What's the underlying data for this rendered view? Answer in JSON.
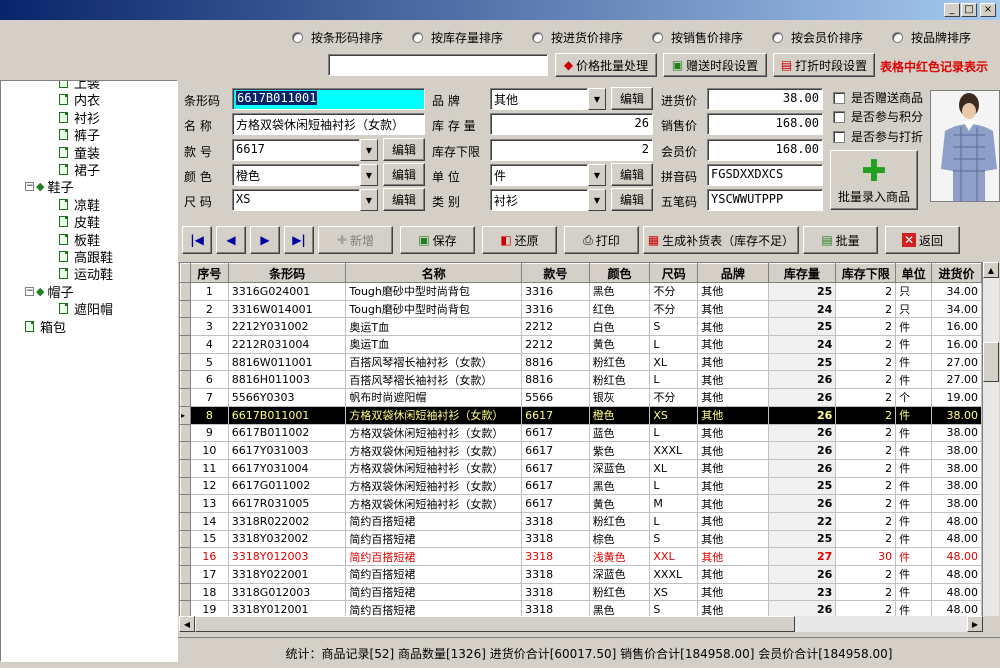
{
  "window": {
    "min": "_",
    "max": "□",
    "close": "×"
  },
  "sort_options": [
    "按条形码排序",
    "按库存量排序",
    "按进货价排序",
    "按销售价排序",
    "按会员价排序",
    "按品牌排序"
  ],
  "toolbar": {
    "search_value": "",
    "price_batch": "价格批量处理",
    "gift_period": "赠送时段设置",
    "discount_period": "打折时段设置",
    "red_notice": "表格中红色记录表示"
  },
  "tree": {
    "items": [
      {
        "label": "上装",
        "level": 2
      },
      {
        "label": "内衣",
        "level": 2
      },
      {
        "label": "衬衫",
        "level": 2
      },
      {
        "label": "裤子",
        "level": 2
      },
      {
        "label": "童装",
        "level": 2
      },
      {
        "label": "裙子",
        "level": 2
      },
      {
        "label": "鞋子",
        "level": 1,
        "expander": "−"
      },
      {
        "label": "凉鞋",
        "level": 2
      },
      {
        "label": "皮鞋",
        "level": 2
      },
      {
        "label": "板鞋",
        "level": 2
      },
      {
        "label": "高跟鞋",
        "level": 2
      },
      {
        "label": "运动鞋",
        "level": 2
      },
      {
        "label": "帽子",
        "level": 1,
        "expander": "−"
      },
      {
        "label": "遮阳帽",
        "level": 2
      },
      {
        "label": "箱包",
        "level": 1
      }
    ]
  },
  "form": {
    "barcode_label": "条形码",
    "barcode": "6617B011001",
    "name_label": "名  称",
    "name": "方格双袋休闲短袖衬衫（女款）",
    "style_label": "款  号",
    "style": "6617",
    "color_label": "颜  色",
    "color": "橙色",
    "size_label": "尺  码",
    "size": "XS",
    "brand_label": "品    牌",
    "brand": "其他",
    "stock_label": "库 存 量",
    "stock": "26",
    "stock_min_label": "库存下限",
    "stock_min": "2",
    "unit_label": "单    位",
    "unit": "件",
    "category_label": "类    别",
    "category": "衬衫",
    "cost_label": "进货价",
    "cost": "38.00",
    "sale_label": "销售价",
    "sale": "168.00",
    "member_label": "会员价",
    "member": "168.00",
    "pinyin_label": "拼音码",
    "pinyin": "FGSDXXDXCS",
    "wubi_label": "五笔码",
    "wubi": "YSCWWUTPPP",
    "edit_label": "编辑",
    "chk_gift": "是否赠送商品",
    "chk_points": "是否参与积分",
    "chk_discount": "是否参与打折",
    "batch_entry": "批量录入商品"
  },
  "actions": {
    "add": "新增",
    "save": "保存",
    "restore": "还原",
    "print": "打印",
    "replenish": "生成补货表（库存不足）",
    "batch": "批量",
    "back": "返回"
  },
  "grid": {
    "columns": [
      "序号",
      "条形码",
      "名称",
      "款号",
      "颜色",
      "尺码",
      "品牌",
      "库存量",
      "库存下限",
      "单位",
      "进货价"
    ],
    "rows": [
      [
        "1",
        "3316G024001",
        "Tough磨砂中型时尚背包",
        "3316",
        "黑色",
        "不分",
        "其他",
        "25",
        "2",
        "只",
        "34.00"
      ],
      [
        "2",
        "3316W014001",
        "Tough磨砂中型时尚背包",
        "3316",
        "红色",
        "不分",
        "其他",
        "24",
        "2",
        "只",
        "34.00"
      ],
      [
        "3",
        "2212Y031002",
        "奥运T血",
        "2212",
        "白色",
        "S",
        "其他",
        "25",
        "2",
        "件",
        "16.00"
      ],
      [
        "4",
        "2212R031004",
        "奥运T血",
        "2212",
        "黄色",
        "L",
        "其他",
        "24",
        "2",
        "件",
        "16.00"
      ],
      [
        "5",
        "8816W011001",
        "百搭风琴褶长袖衬衫（女款）",
        "8816",
        "粉红色",
        "XL",
        "其他",
        "25",
        "2",
        "件",
        "27.00"
      ],
      [
        "6",
        "8816H011003",
        "百搭风琴褶长袖衬衫（女款）",
        "8816",
        "粉红色",
        "L",
        "其他",
        "26",
        "2",
        "件",
        "27.00"
      ],
      [
        "7",
        "5566Y0303",
        "帆布时尚遮阳帽",
        "5566",
        "银灰",
        "不分",
        "其他",
        "26",
        "2",
        "个",
        "19.00"
      ],
      [
        "8",
        "6617B011001",
        "方格双袋休闲短袖衬衫（女款）",
        "6617",
        "橙色",
        "XS",
        "其他",
        "26",
        "2",
        "件",
        "38.00"
      ],
      [
        "9",
        "6617B011002",
        "方格双袋休闲短袖衬衫（女款）",
        "6617",
        "蓝色",
        "L",
        "其他",
        "26",
        "2",
        "件",
        "38.00"
      ],
      [
        "10",
        "6617Y031003",
        "方格双袋休闲短袖衬衫（女款）",
        "6617",
        "紫色",
        "XXXL",
        "其他",
        "26",
        "2",
        "件",
        "38.00"
      ],
      [
        "11",
        "6617Y031004",
        "方格双袋休闲短袖衬衫（女款）",
        "6617",
        "深蓝色",
        "XL",
        "其他",
        "26",
        "2",
        "件",
        "38.00"
      ],
      [
        "12",
        "6617G011002",
        "方格双袋休闲短袖衬衫（女款）",
        "6617",
        "黑色",
        "L",
        "其他",
        "25",
        "2",
        "件",
        "38.00"
      ],
      [
        "13",
        "6617R031005",
        "方格双袋休闲短袖衬衫（女款）",
        "6617",
        "黄色",
        "M",
        "其他",
        "26",
        "2",
        "件",
        "38.00"
      ],
      [
        "14",
        "3318R022002",
        "简约百搭短裙",
        "3318",
        "粉红色",
        "L",
        "其他",
        "22",
        "2",
        "件",
        "48.00"
      ],
      [
        "15",
        "3318Y032002",
        "简约百搭短裙",
        "3318",
        "棕色",
        "S",
        "其他",
        "25",
        "2",
        "件",
        "48.00"
      ],
      [
        "16",
        "3318Y012003",
        "简约百搭短裙",
        "3318",
        "浅黄色",
        "XXL",
        "其他",
        "27",
        "30",
        "件",
        "48.00"
      ],
      [
        "17",
        "3318Y022001",
        "简约百搭短裙",
        "3318",
        "深蓝色",
        "XXXL",
        "其他",
        "26",
        "2",
        "件",
        "48.00"
      ],
      [
        "18",
        "3318G012003",
        "简约百搭短裙",
        "3318",
        "粉红色",
        "XS",
        "其他",
        "23",
        "2",
        "件",
        "48.00"
      ],
      [
        "19",
        "3318Y012001",
        "简约百搭短裙",
        "3318",
        "黑色",
        "S",
        "其他",
        "26",
        "2",
        "件",
        "48.00"
      ]
    ],
    "selected_index": 7,
    "red_index": 15
  },
  "status": {
    "text": "统计：商品记录[52] 商品数量[1326] 进货价合计[60017.50] 销售价合计[184958.00] 会员价合计[184958.00]"
  },
  "colors": {
    "selected_bg": "#000000",
    "selected_fg": "#ffff80",
    "warn_red": "#e00000",
    "barcode_bg": "#00ffff"
  }
}
